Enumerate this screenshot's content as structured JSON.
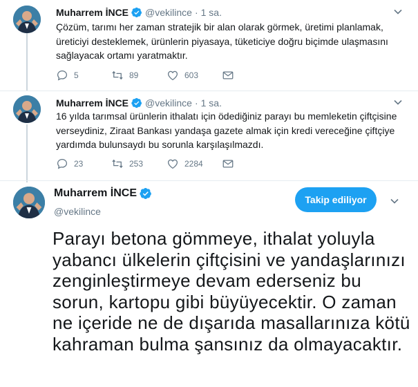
{
  "tweets": [
    {
      "name": "Muharrem İNCE",
      "handle": "@vekilince",
      "separator": "·",
      "time": "1 sa.",
      "text": "Çözüm, tarımı her zaman stratejik bir alan olarak görmek, üretimi planlamak, üreticiyi desteklemek, ürünlerin piyasaya, tüketiciye doğru biçimde ulaşmasını sağlayacak ortamı yaratmaktır.",
      "replies": "5",
      "retweets": "89",
      "likes": "603"
    },
    {
      "name": "Muharrem İNCE",
      "handle": "@vekilince",
      "separator": "·",
      "time": "1 sa.",
      "text": "16 yılda tarımsal ürünlerin ithalatı için ödediğiniz parayı bu memleketin çiftçisine verseydiniz, Ziraat Bankası yandaşa gazete almak için kredi vereceğine çiftçiye yardımda bulunsaydı bu sorunla karşılaşılmazdı.",
      "replies": "23",
      "retweets": "253",
      "likes": "2284"
    }
  ],
  "main_tweet": {
    "name": "Muharrem İNCE",
    "handle": "@vekilince",
    "follow_label": "Takip ediliyor",
    "text": "Parayı betona gömmeye, ithalat yoluyla yabancı ülkelerin çiftçisini ve yandaşlarınızı zenginleştirmeye devam ederseniz bu sorun, kartopu gibi büyüyecektir. O zaman ne içeride ne de dışarıda masallarınıza kötü kahraman bulma şansınız da olmayacaktır."
  },
  "colors": {
    "accent": "#1da1f2",
    "muted": "#657786",
    "text": "#14171a",
    "thread_line": "#ccd6dd"
  },
  "icons": [
    "verified-badge-icon",
    "chevron-down-icon",
    "reply-icon",
    "retweet-icon",
    "like-icon",
    "dm-icon"
  ]
}
